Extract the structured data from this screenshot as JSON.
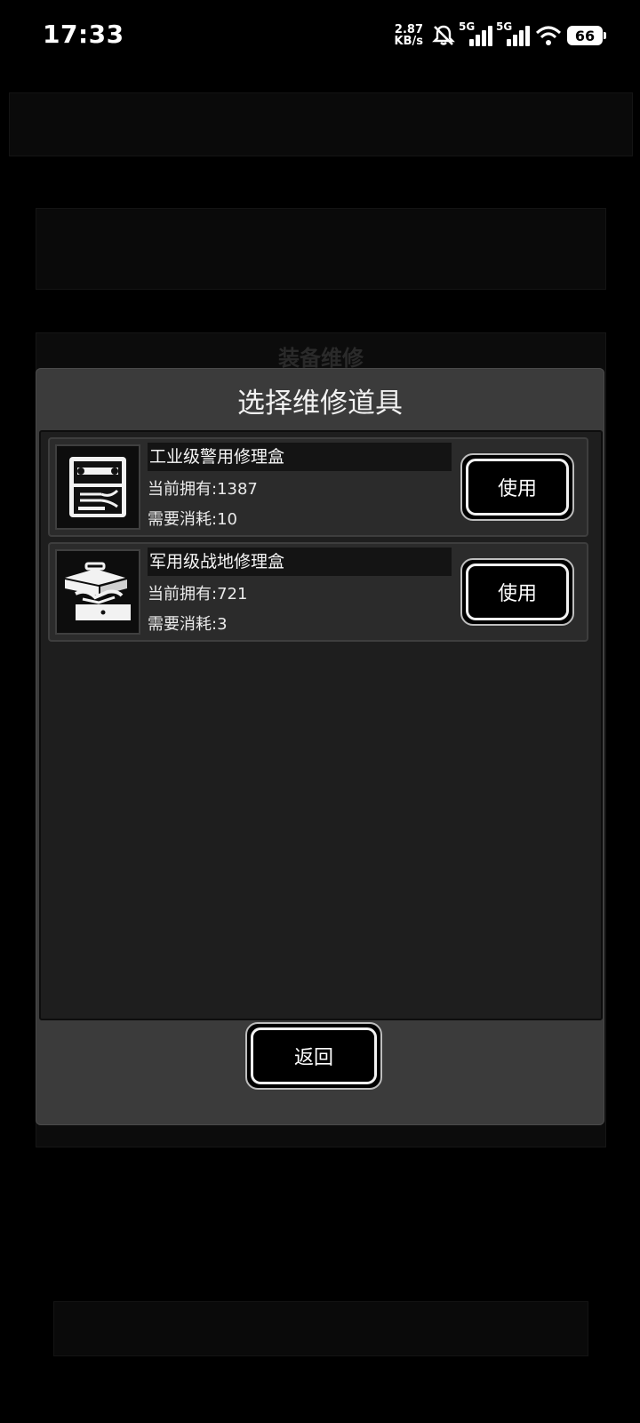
{
  "status_bar": {
    "time": "17:33",
    "net_speed_value": "2.87",
    "net_speed_unit": "KB/s",
    "sim1_type": "5G",
    "sim2_type": "5G",
    "battery": "66"
  },
  "background": {
    "panel_title": "装备维修"
  },
  "dialog": {
    "title": "选择维修道具",
    "items": [
      {
        "name": "工业级警用修理盒",
        "owned": "当前拥有:1387",
        "cost": "需要消耗:10",
        "icon": "toolbox-case-icon",
        "button": "使用"
      },
      {
        "name": "军用级战地修理盒",
        "owned": "当前拥有:721",
        "cost": "需要消耗:3",
        "icon": "cantilever-toolbox-icon",
        "button": "使用"
      }
    ],
    "back_label": "返回"
  }
}
